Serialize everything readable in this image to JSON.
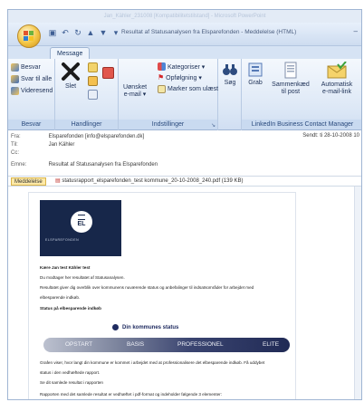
{
  "ghost_title": "Jan_Kähler_231008 [Kompatibilitetstilstand] - Microsoft PowerPoint",
  "window": {
    "title": "Resultat af Statusanalysen fra Elsparefonden - Meddelelse (HTML)",
    "minimize": "–"
  },
  "qat": {
    "save": "▣",
    "undo": "↶",
    "redo": "↻",
    "up": "▲",
    "down": "▼",
    "more": "▾"
  },
  "tabs": [
    {
      "label": "Message"
    }
  ],
  "ribbon": {
    "besvar": {
      "label": "Besvar",
      "reply": "Besvar",
      "reply_all": "Svar til alle",
      "forward": "Videresend"
    },
    "handlinger": {
      "label": "Handlinger",
      "delete": "Slet"
    },
    "uonsket": {
      "label_line1": "Uønsket",
      "label_line2": "e-mail ▾"
    },
    "indstillinger": {
      "label": "Indstillinger",
      "categorize": "Kategoriser ▾",
      "followup": "Opfølgning ▾",
      "mark_unread": "Marker som ulæst"
    },
    "search": {
      "label": "Søg"
    },
    "linkedin": {
      "label": "LinkedIn Business Contact Manager",
      "grab": "Grab",
      "combined_line1": "Sammenkæd",
      "combined_line2": "til post",
      "auto_line1": "Automatisk",
      "auto_line2": "e-mail-link"
    }
  },
  "headers": {
    "from_label": "Fra:",
    "from_value": "Elsparefonden [info@elsparefonden.dk]",
    "to_label": "Til:",
    "to_value": "Jan Kähler",
    "cc_label": "Cc:",
    "cc_value": "",
    "subject_label": "Emne:",
    "subject_value": "Resultat af Statusanalysen fra Elsparefonden",
    "sent": "Sendt:  ti 28-10-2008 10"
  },
  "attachments": {
    "message_tab": "Meddelelse",
    "file": "statusrapport_elsparefonden_test kommune_20-10-2008_240.pdf (139 KB)"
  },
  "body": {
    "banner_logo": "EL",
    "banner_sub": "ELSPAREFONDEN",
    "greeting": "Kære Jan test Kähler test",
    "p1": "Du modtager her resultatet af Statusanalysen.",
    "p2": "Resultatet giver dig overblik over kommunens nuværende status og anbefalinger til indsatsområder for arbejdet med",
    "p3": "elbesparende indkøb.",
    "section_title": "Status på elbesparende indkøb",
    "marker": "Din kommunes status",
    "scale": [
      "OPSTART",
      "BASIS",
      "PROFESSIONEL",
      "ELITE"
    ],
    "p4": "Grafen viser, hvor langt din kommune er kommet i arbejdet med at professionalisere det elbesparende indkøb. Få uddybet",
    "p5": "status i den vedhæftede rapport.",
    "p6": "Se dit samlede resultat i rapporten",
    "p7": "Rapporten med det samlede resultat er vedhæftet i pdf-format og indeholder følgende 3 elementer:"
  }
}
